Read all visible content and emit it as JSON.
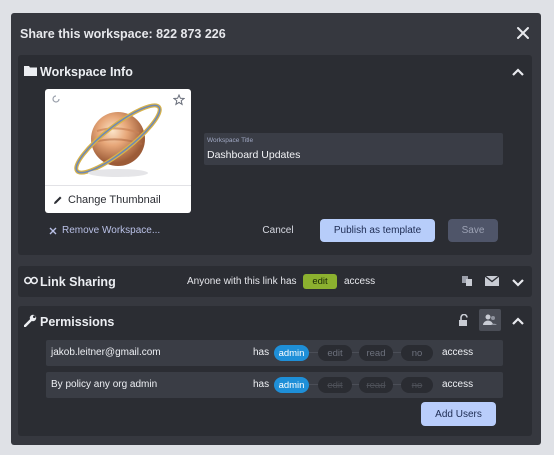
{
  "modal": {
    "title": "Share this workspace: 822 873 226"
  },
  "workspace_info": {
    "title": "Workspace Info",
    "change_thumbnail": "Change Thumbnail",
    "title_field_label": "Workspace Title",
    "title_field_value": "Dashboard Updates",
    "remove_label": "Remove Workspace...",
    "cancel_label": "Cancel",
    "publish_label": "Publish as template",
    "save_label": "Save"
  },
  "link_sharing": {
    "title": "Link Sharing",
    "prefix": "Anyone with this link has",
    "level": "edit",
    "suffix": "access"
  },
  "permissions": {
    "title": "Permissions",
    "rows": [
      {
        "who": "jakob.leitner@gmail.com",
        "has": "has",
        "levels": [
          "admin",
          "edit",
          "read",
          "no"
        ],
        "selected": "admin",
        "access": "access"
      },
      {
        "who": "By policy any org admin",
        "has": "has",
        "levels": [
          "admin",
          "edit",
          "read",
          "no"
        ],
        "selected": "admin",
        "access": "access"
      }
    ],
    "add_users_label": "Add Users"
  },
  "colors": {
    "modal_bg": "#36383f",
    "panel_bg": "#2b2d33",
    "primary_button": "#b7cdfa",
    "edit_pill": "#8cb12f",
    "admin_selected": "#1e8fd8"
  },
  "icons": [
    "close-icon",
    "folder-icon",
    "chevron-up-icon",
    "chevron-down-icon",
    "link-icon",
    "wrench-icon",
    "copy-icon",
    "mail-icon",
    "unlock-icon",
    "user-group-icon",
    "pencil-icon",
    "star-icon",
    "refresh-icon",
    "x-icon",
    "planet-icon"
  ]
}
